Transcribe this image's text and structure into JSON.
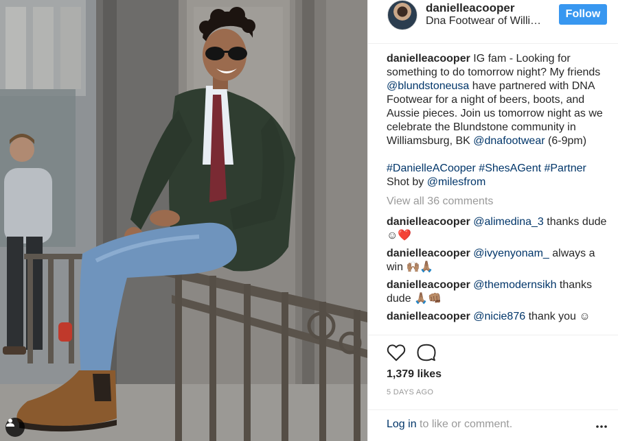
{
  "post": {
    "username": "danielleacooper",
    "location": "Dna Footwear of Willi…",
    "follow_label": "Follow",
    "caption": {
      "username": "danielleacooper",
      "text_1": " IG fam - Looking for something to do tomorrow night? My friends ",
      "mention_1": "@blundstoneusa",
      "text_2": " have partnered with DNA Footwear for a night of beers, boots, and Aussie pieces. Join us tomorrow night as we celebrate the Blundstone community in Williamsburg, BK ",
      "mention_2": "@dnafootwear",
      "text_3": " (6-9pm)",
      "hashtags": "#DanielleACooper #ShesAGent #Partner",
      "shot_by": "Shot by ",
      "mention_3": "@milesfrom"
    },
    "view_all": "View all 36 comments",
    "comments": [
      {
        "username": "danielleacooper",
        "mention": "@alimedina_3",
        "text": " thanks dude ☺",
        "emoji": "❤️"
      },
      {
        "username": "danielleacooper",
        "mention": "@ivyenyonam_",
        "text": " always a win ",
        "emoji": "🙌🏽🙏🏽"
      },
      {
        "username": "danielleacooper",
        "mention": "@themodernsikh",
        "text": " thanks dude ",
        "emoji": "🙏🏽👊🏽"
      },
      {
        "username": "danielleacooper",
        "mention": "@nicie876",
        "text": " thank you ☺",
        "emoji": ""
      }
    ],
    "likes": "1,379 likes",
    "time": "5 DAYS AGO",
    "login_link": "Log in",
    "login_rest": " to like or comment."
  },
  "colors": {
    "accent": "#3897f0",
    "link": "#003569",
    "muted": "#999999",
    "text": "#262626"
  },
  "icons": [
    "user-tag-icon",
    "heart-icon",
    "comment-icon",
    "more-options-icon"
  ]
}
